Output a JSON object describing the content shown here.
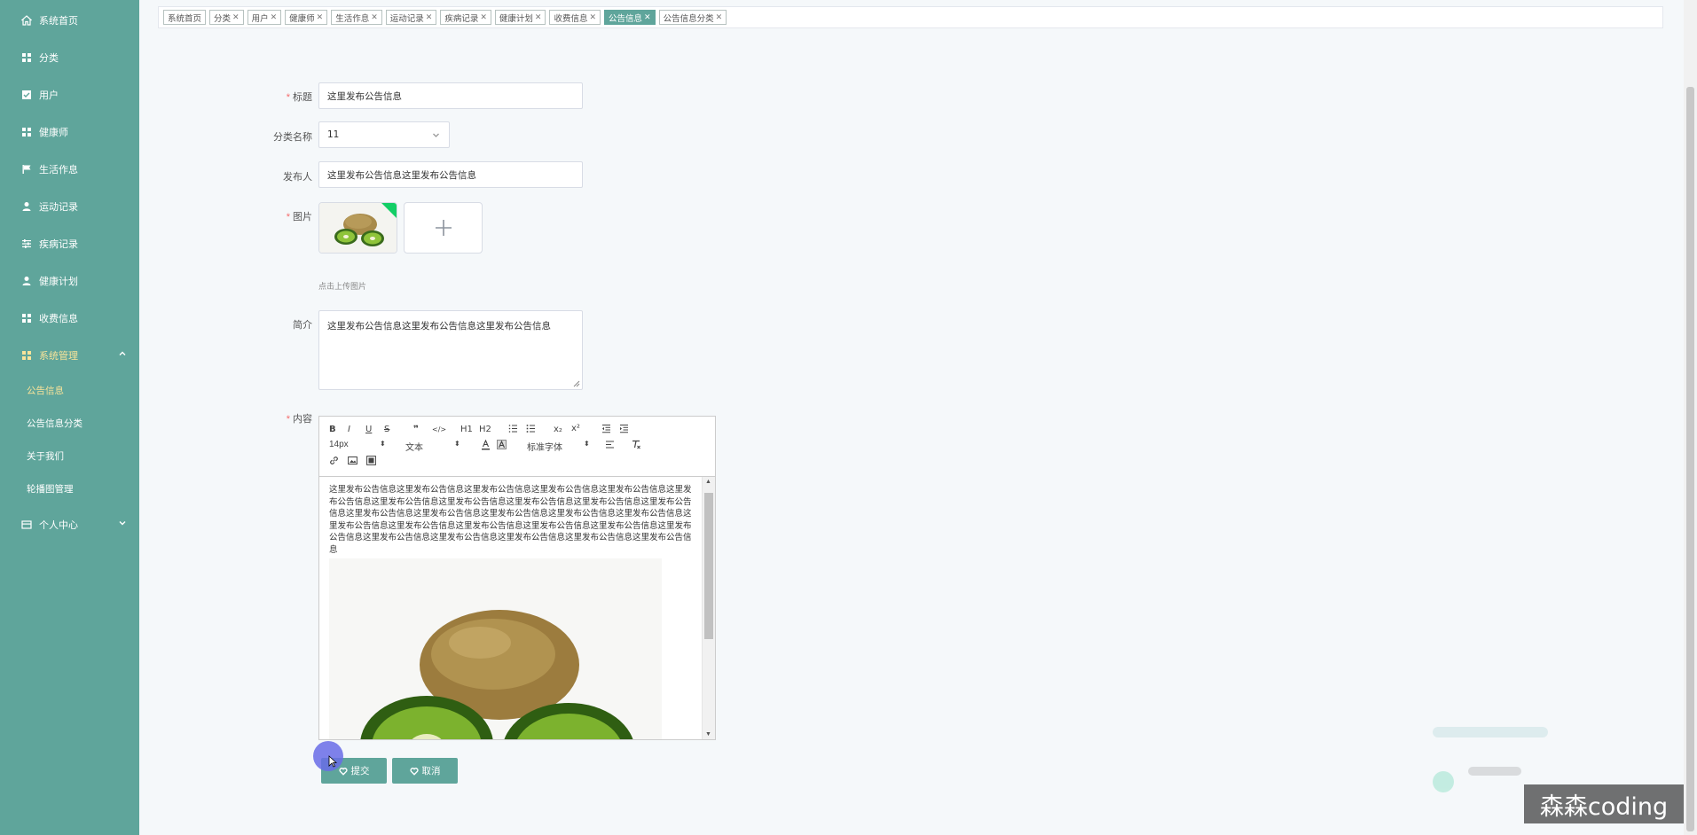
{
  "sidebar": {
    "items": [
      {
        "label": "系统首页",
        "icon": "home-icon"
      },
      {
        "label": "分类",
        "icon": "grid-icon"
      },
      {
        "label": "用户",
        "icon": "checkbox-icon"
      },
      {
        "label": "健康师",
        "icon": "grid-icon"
      },
      {
        "label": "生活作息",
        "icon": "flag-icon"
      },
      {
        "label": "运动记录",
        "icon": "user-icon"
      },
      {
        "label": "疾病记录",
        "icon": "sliders-icon"
      },
      {
        "label": "健康计划",
        "icon": "user-icon"
      },
      {
        "label": "收费信息",
        "icon": "grid-icon"
      },
      {
        "label": "系统管理",
        "icon": "grid-icon"
      }
    ],
    "submenu": [
      "公告信息",
      "公告信息分类",
      "关于我们",
      "轮播图管理"
    ],
    "last_item": {
      "label": "个人中心",
      "icon": "card-icon"
    }
  },
  "tabs": [
    {
      "label": "系统首页",
      "closable": false
    },
    {
      "label": "分类",
      "closable": true
    },
    {
      "label": "用户",
      "closable": true
    },
    {
      "label": "健康师",
      "closable": true
    },
    {
      "label": "生活作息",
      "closable": true
    },
    {
      "label": "运动记录",
      "closable": true
    },
    {
      "label": "疾病记录",
      "closable": true
    },
    {
      "label": "健康计划",
      "closable": true
    },
    {
      "label": "收费信息",
      "closable": true
    },
    {
      "label": "公告信息",
      "closable": true,
      "active": true
    },
    {
      "label": "公告信息分类",
      "closable": true
    }
  ],
  "form": {
    "title_label": "标题",
    "title_value": "这里发布公告信息",
    "category_label": "分类名称",
    "category_value": "11",
    "publisher_label": "发布人",
    "publisher_value": "这里发布公告信息这里发布公告信息",
    "image_label": "图片",
    "upload_hint": "点击上传图片",
    "intro_label": "简介",
    "intro_value": "这里发布公告信息这里发布公告信息这里发布公告信息",
    "content_label": "内容",
    "content_text": "这里发布公告信息这里发布公告信息这里发布公告信息这里发布公告信息这里发布公告信息这里发布公告信息这里发布公告信息这里发布公告信息这里发布公告信息这里发布公告信息这里发布公告信息这里发布公告信息这里发布公告信息这里发布公告信息这里发布公告信息这里发布公告信息这里发布公告信息这里发布公告信息这里发布公告信息这里发布公告信息这里发布公告信息这里发布公告信息这里发布公告信息这里发布公告信息这里发布公告信息这里发布公告信息这里发布公告信息",
    "submit_label": "提交",
    "cancel_label": "取消"
  },
  "editor_toolbar": {
    "bold": "B",
    "italic": "I",
    "underline": "U",
    "strike": "S",
    "quote": "❞",
    "code": "</>",
    "h1": "H1",
    "h2": "H2",
    "sub": "x₂",
    "sup": "x²",
    "font_size": "14px",
    "text_style": "文本",
    "font_family": "标准字体"
  },
  "watermark": "森森coding",
  "colors": {
    "sidebar": "#5fa59b",
    "accent": "#5fa59b",
    "active_text": "#f7e39a",
    "required": "#f56c6c"
  }
}
